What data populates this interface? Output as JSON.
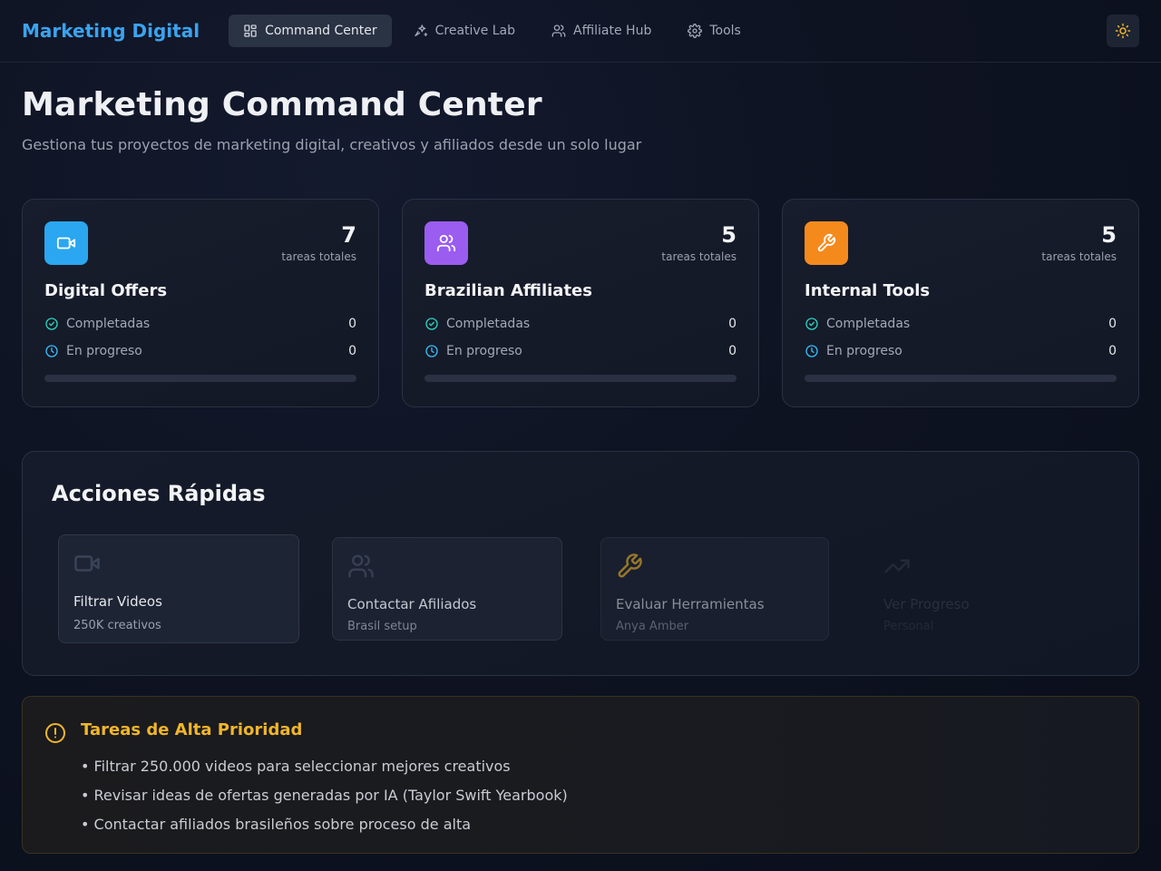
{
  "nav": {
    "brand": "Marketing Digital",
    "tabs": [
      {
        "label": "Command Center",
        "icon": "layout-grid-icon",
        "active": true
      },
      {
        "label": "Creative Lab",
        "icon": "sparkles-icon",
        "active": false
      },
      {
        "label": "Affiliate Hub",
        "icon": "users-icon",
        "active": false
      },
      {
        "label": "Tools",
        "icon": "gear-icon",
        "active": false
      }
    ],
    "theme_icon": "sun-icon"
  },
  "header": {
    "title": "Marketing Command Center",
    "subtitle": "Gestiona tus proyectos de marketing digital, creativos y afiliados desde un solo lugar"
  },
  "cards": [
    {
      "title": "Digital Offers",
      "count": "7",
      "count_label": "tareas totales",
      "icon": "video-icon",
      "color": "#2aa7f0",
      "completed_label": "Completadas",
      "completed": "0",
      "progress_label": "En progreso",
      "progress": "0",
      "progress_fraction": 0
    },
    {
      "title": "Brazilian Affiliates",
      "count": "5",
      "count_label": "tareas totales",
      "icon": "users-icon",
      "color": "#9b5cf0",
      "completed_label": "Completadas",
      "completed": "0",
      "progress_label": "En progreso",
      "progress": "0",
      "progress_fraction": 0
    },
    {
      "title": "Internal Tools",
      "count": "5",
      "count_label": "tareas totales",
      "icon": "wrench-icon",
      "color": "#f58a1c",
      "completed_label": "Completadas",
      "completed": "0",
      "progress_label": "En progreso",
      "progress": "0",
      "progress_fraction": 0
    }
  ],
  "quick_actions": {
    "title": "Acciones Rápidas",
    "items": [
      {
        "title": "Filtrar Videos",
        "subtitle": "250K creativos",
        "icon": "video-icon"
      },
      {
        "title": "Contactar Afiliados",
        "subtitle": "Brasil setup",
        "icon": "users-icon"
      },
      {
        "title": "Evaluar Herramientas",
        "subtitle": "Anya Amber",
        "icon": "wrench-icon"
      },
      {
        "title": "Ver Progreso",
        "subtitle": "Personal",
        "icon": "trending-up-icon"
      }
    ]
  },
  "priority": {
    "title": "Tareas de Alta Prioridad",
    "icon": "alert-circle-icon",
    "items": [
      "• Filtrar 250.000 videos para seleccionar mejores creativos",
      "• Revisar ideas de ofertas generadas por IA (Taylor Swift Yearbook)",
      "• Contactar afiliados brasileños sobre proceso de alta"
    ]
  },
  "colors": {
    "accent": "#3ba3ee",
    "completed_icon": "#2dd4bf",
    "progress_icon": "#38bdf8",
    "warning": "#f0b52b"
  }
}
